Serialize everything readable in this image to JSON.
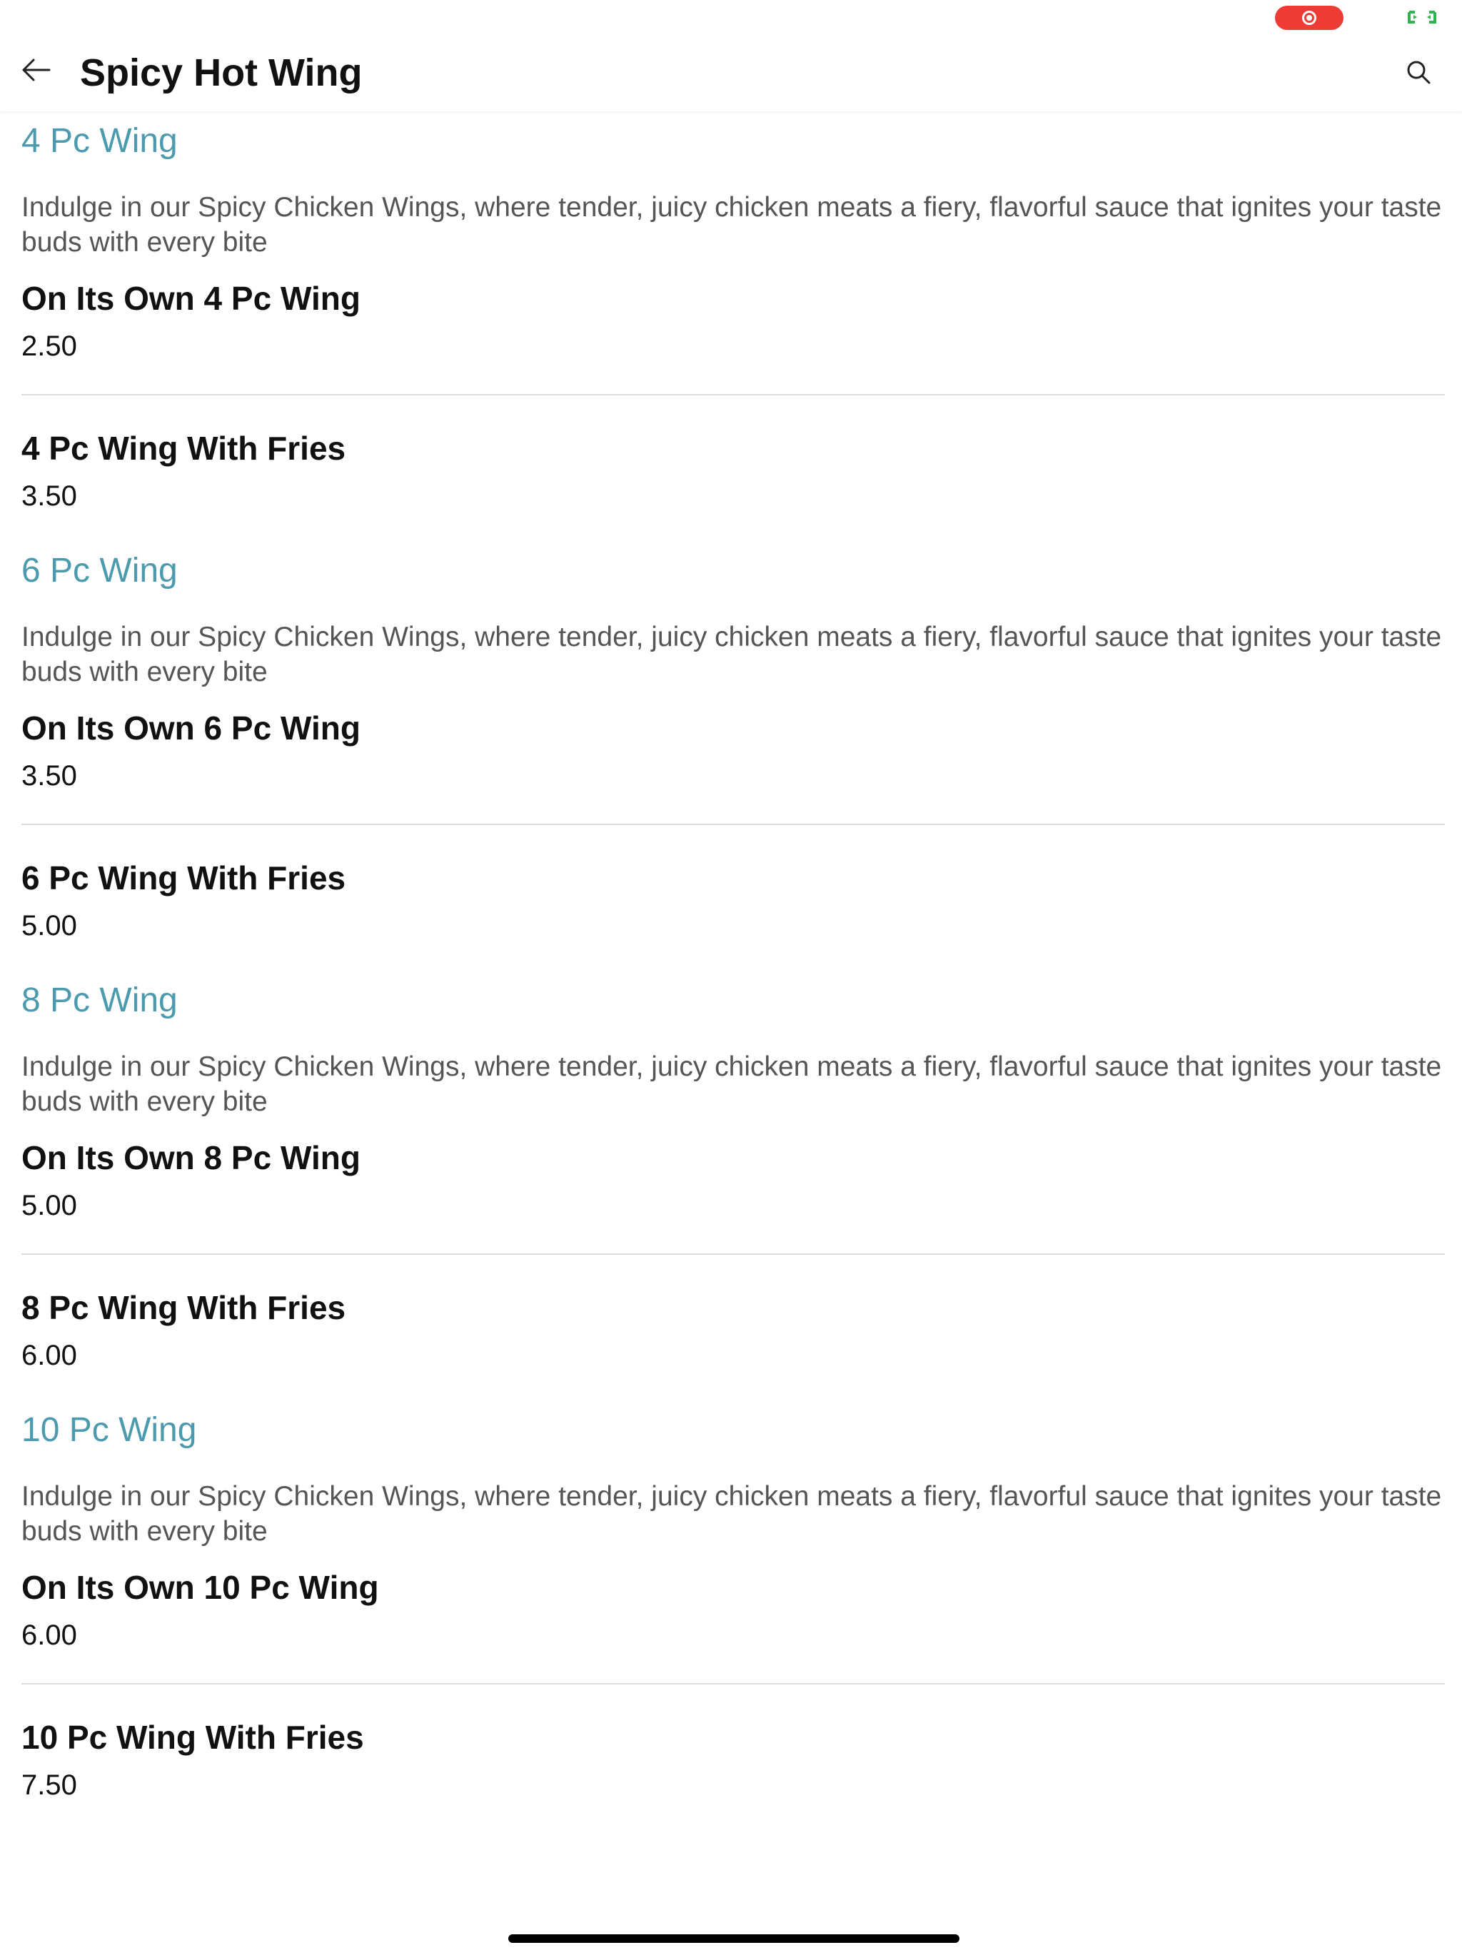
{
  "status": {
    "record_icon": "screen-record-icon",
    "record_color": "#ef3b35",
    "mirror_icon": "screen-mirror-icon",
    "mirror_color": "#2fb34f"
  },
  "nav": {
    "back_icon": "arrow-left-icon",
    "title": "Spicy Hot Wing",
    "search_icon": "search-icon"
  },
  "colors": {
    "section_title": "#4b9aad",
    "description": "#555555",
    "divider": "#dddddd"
  },
  "sections": [
    {
      "title": "4 Pc Wing",
      "description": "Indulge in our Spicy Chicken Wings, where tender, juicy chicken meats a fiery, flavorful sauce that ignites your taste buds with every bite",
      "items": [
        {
          "name": "On Its Own 4 Pc Wing",
          "price": "2.50"
        },
        {
          "name": "4 Pc Wing With Fries",
          "price": "3.50"
        }
      ]
    },
    {
      "title": "6 Pc Wing",
      "description": "Indulge in our Spicy Chicken Wings, where tender, juicy chicken meats a fiery, flavorful sauce that ignites your taste buds with every bite",
      "items": [
        {
          "name": "On Its Own 6 Pc Wing",
          "price": "3.50"
        },
        {
          "name": "6 Pc Wing With Fries",
          "price": "5.00"
        }
      ]
    },
    {
      "title": "8 Pc Wing",
      "description": "Indulge in our Spicy Chicken Wings, where tender, juicy chicken meats a fiery, flavorful sauce that ignites your taste buds with every bite",
      "items": [
        {
          "name": "On Its Own 8 Pc Wing",
          "price": "5.00"
        },
        {
          "name": "8 Pc Wing With Fries",
          "price": "6.00"
        }
      ]
    },
    {
      "title": "10 Pc Wing",
      "description": "Indulge in our Spicy Chicken Wings, where tender, juicy chicken meats a fiery, flavorful sauce that ignites your taste buds with every bite",
      "items": [
        {
          "name": "On Its Own 10 Pc Wing",
          "price": "6.00"
        },
        {
          "name": "10 Pc Wing With Fries",
          "price": "7.50"
        }
      ]
    }
  ]
}
